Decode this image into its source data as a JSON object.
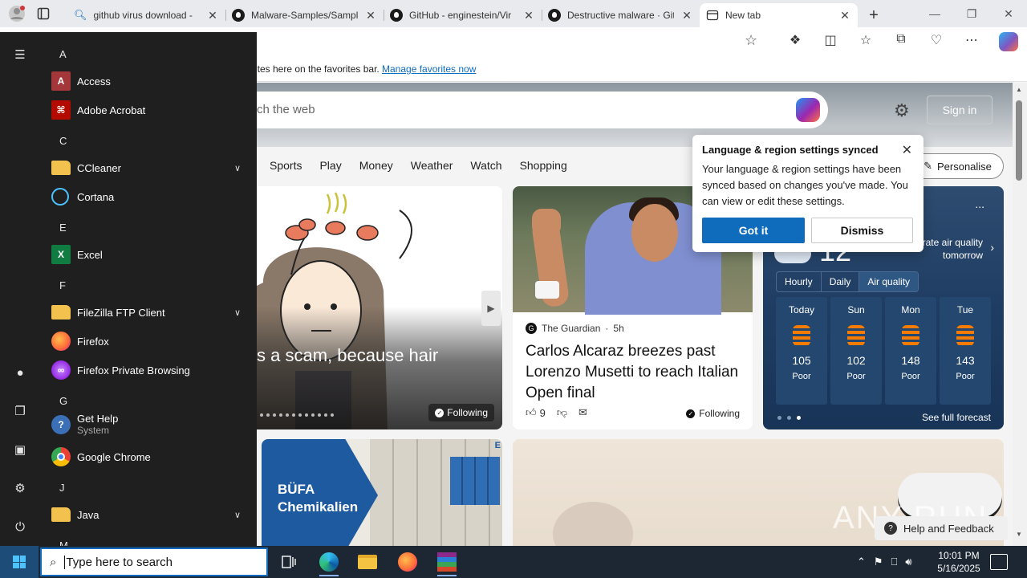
{
  "browser": {
    "tabs": [
      {
        "label": "github virus download -",
        "icon": "search-icon",
        "active": false
      },
      {
        "label": "Malware-Samples/Sampl",
        "icon": "github-icon",
        "active": false
      },
      {
        "label": "GitHub - enginestein/Vir",
        "icon": "github-icon",
        "active": false
      },
      {
        "label": "Destructive malware · Git",
        "icon": "github-icon",
        "active": false
      },
      {
        "label": "New tab",
        "icon": "newtab-icon",
        "active": true
      }
    ],
    "favorites_bar": {
      "text": "ites here on the favorites bar.",
      "link": "Manage favorites now"
    }
  },
  "ntp": {
    "search_placeholder": "ch the web",
    "sign_in": "Sign in",
    "nav": [
      "Sports",
      "Play",
      "Money",
      "Weather",
      "Watch",
      "Shopping"
    ],
    "personalise": "Personalise",
    "card1": {
      "headline": "s a scam, because hair",
      "following": "Following"
    },
    "card2": {
      "source": "The Guardian",
      "age": "5h",
      "title": "Carlos Alcaraz breezes past Lorenzo Musetti to reach Italian Open final",
      "likes": "9",
      "following": "Following"
    },
    "weather": {
      "more": "...",
      "temperature": "12",
      "air_quality_note": "Moderate air quality tomorrow",
      "tabs": [
        "Hourly",
        "Daily",
        "Air quality"
      ],
      "days": [
        {
          "name": "Today",
          "value": "105",
          "level": "Poor"
        },
        {
          "name": "Sun",
          "value": "102",
          "level": "Poor"
        },
        {
          "name": "Mon",
          "value": "148",
          "level": "Poor"
        },
        {
          "name": "Tue",
          "value": "143",
          "level": "Poor"
        }
      ],
      "see_full_forecast": "See full forecast"
    },
    "ad": {
      "brand_line1": "BÜFA",
      "brand_line2": "Chemikalien",
      "flag": "E"
    },
    "feedback": "Help and Feedback",
    "watermark": "ANY RUN"
  },
  "popup": {
    "title": "Language & region settings synced",
    "body": "Your language & region settings have been synced based on changes you've made. You can view or edit these settings.",
    "got_it": "Got it",
    "dismiss": "Dismiss"
  },
  "start_menu": {
    "groups": [
      {
        "letter": "A",
        "apps": [
          {
            "name": "Access",
            "icon": "access-icon"
          },
          {
            "name": "Adobe Acrobat",
            "icon": "acrobat-icon"
          }
        ]
      },
      {
        "letter": "C",
        "apps": [
          {
            "name": "CCleaner",
            "icon": "folder-icon",
            "expandable": true
          },
          {
            "name": "Cortana",
            "icon": "cortana-icon"
          }
        ]
      },
      {
        "letter": "E",
        "apps": [
          {
            "name": "Excel",
            "icon": "excel-icon"
          }
        ]
      },
      {
        "letter": "F",
        "apps": [
          {
            "name": "FileZilla FTP Client",
            "icon": "folder-icon",
            "expandable": true
          },
          {
            "name": "Firefox",
            "icon": "firefox-icon"
          },
          {
            "name": "Firefox Private Browsing",
            "icon": "firefox-private-icon"
          }
        ]
      },
      {
        "letter": "G",
        "apps": [
          {
            "name": "Get Help",
            "sub": "System",
            "icon": "get-help-icon"
          },
          {
            "name": "Google Chrome",
            "icon": "chrome-icon"
          }
        ]
      },
      {
        "letter": "J",
        "apps": [
          {
            "name": "Java",
            "icon": "folder-icon",
            "expandable": true
          }
        ]
      },
      {
        "letter": "M",
        "apps": []
      }
    ]
  },
  "taskbar": {
    "search_placeholder": "Type here to search",
    "time": "10:01 PM",
    "date": "5/16/2025"
  },
  "colors": {
    "accent": "#0f6cbd",
    "start_bg": "#1f1f1f",
    "taskbar_bg": "#1c2733",
    "weather_bg": "#1f3d63"
  }
}
